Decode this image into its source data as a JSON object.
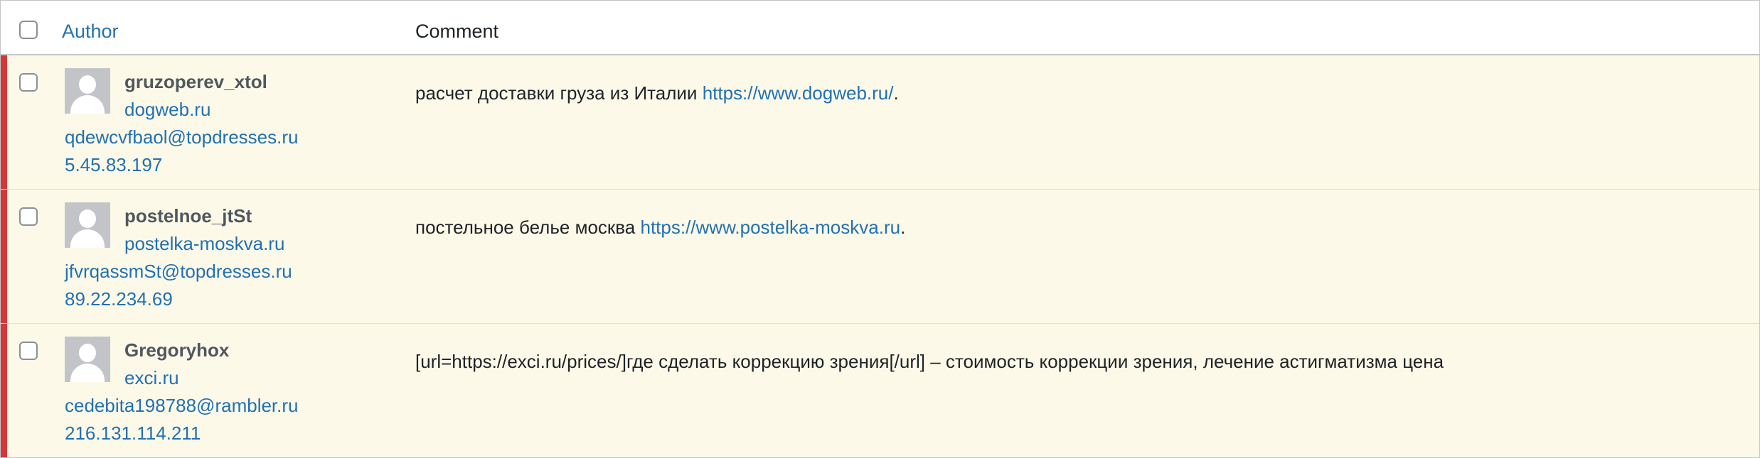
{
  "header": {
    "author_label": "Author",
    "comment_label": "Comment"
  },
  "rows": [
    {
      "author_name": "gruzoperev_xtol",
      "author_url": "dogweb.ru",
      "email": "qdewcvfbaol@topdresses.ru",
      "ip": "5.45.83.197",
      "comment_text": "расчет доставки груза из Италии ",
      "comment_link": "https://www.dogweb.ru/",
      "comment_suffix": "."
    },
    {
      "author_name": "postelnoe_jtSt",
      "author_url": "postelka-moskva.ru",
      "email": "jfvrqassmSt@topdresses.ru",
      "ip": "89.22.234.69",
      "comment_text": "постельное белье москва ",
      "comment_link": "https://www.postelka-moskva.ru",
      "comment_suffix": "."
    },
    {
      "author_name": "Gregoryhox",
      "author_url": "exci.ru",
      "email": "cedebita198788@rambler.ru",
      "ip": "216.131.114.211",
      "comment_text": "[url=https://exci.ru/prices/]где сделать коррекцию зрения[/url] – стоимость коррекции зрения, лечение астигматизма цена",
      "comment_link": "",
      "comment_suffix": ""
    }
  ],
  "colors": {
    "link": "#2271b1",
    "unapproved_bar": "#d63638",
    "unapproved_bg": "#fcf9e8"
  }
}
